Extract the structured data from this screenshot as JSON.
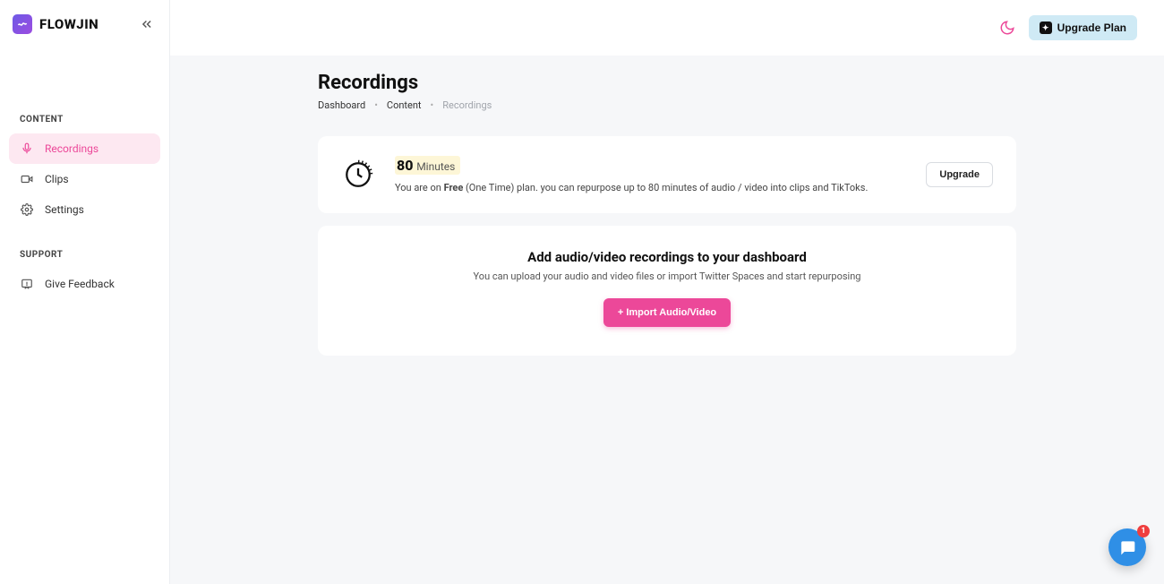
{
  "brand": {
    "name": "FLOWJIN"
  },
  "topbar": {
    "upgrade_plan_label": "Upgrade Plan"
  },
  "sidebar": {
    "sections": {
      "content": {
        "header": "CONTENT",
        "items": [
          {
            "label": "Recordings",
            "active": true
          },
          {
            "label": "Clips"
          },
          {
            "label": "Settings"
          }
        ]
      },
      "support": {
        "header": "SUPPORT",
        "items": [
          {
            "label": "Give Feedback"
          }
        ]
      }
    }
  },
  "page": {
    "title": "Recordings",
    "breadcrumb": [
      "Dashboard",
      "Content",
      "Recordings"
    ]
  },
  "quota": {
    "minutes_value": "80",
    "minutes_label": "Minutes",
    "desc_prefix": "You are on ",
    "desc_plan": "Free",
    "desc_suffix": " (One Time) plan. you can repurpose up to 80 minutes of audio / video into clips and TikToks.",
    "upgrade_label": "Upgrade"
  },
  "empty": {
    "title": "Add audio/video recordings to your dashboard",
    "subtitle": "You can upload your audio and video files or import Twitter Spaces and start repurposing",
    "import_label": "+ Import Audio/Video"
  },
  "chat": {
    "badge": "1"
  }
}
